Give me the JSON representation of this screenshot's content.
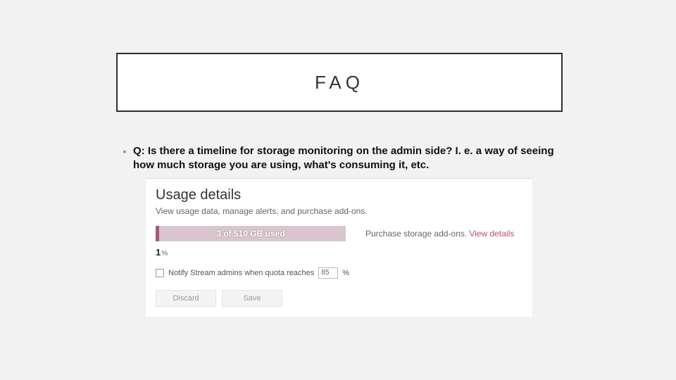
{
  "title": "FAQ",
  "bullet_glyph": "•",
  "question": "Q: Is there a timeline for storage monitoring on the admin side? I. e. a way of seeing how much storage you are using, what's consuming it, etc.",
  "usage": {
    "heading": "Usage details",
    "subtitle": "View usage data, manage alerts, and purchase add-ons.",
    "bar_label": "3 of 510 GB used",
    "addons_prefix": "Purchase storage add-ons. ",
    "addons_link": "View details",
    "percent_value": "1",
    "percent_symbol": "%",
    "notify_label": "Notify Stream admins when quota reaches",
    "quota_value": "85",
    "quota_suffix": "%",
    "discard_label": "Discard",
    "save_label": "Save"
  }
}
